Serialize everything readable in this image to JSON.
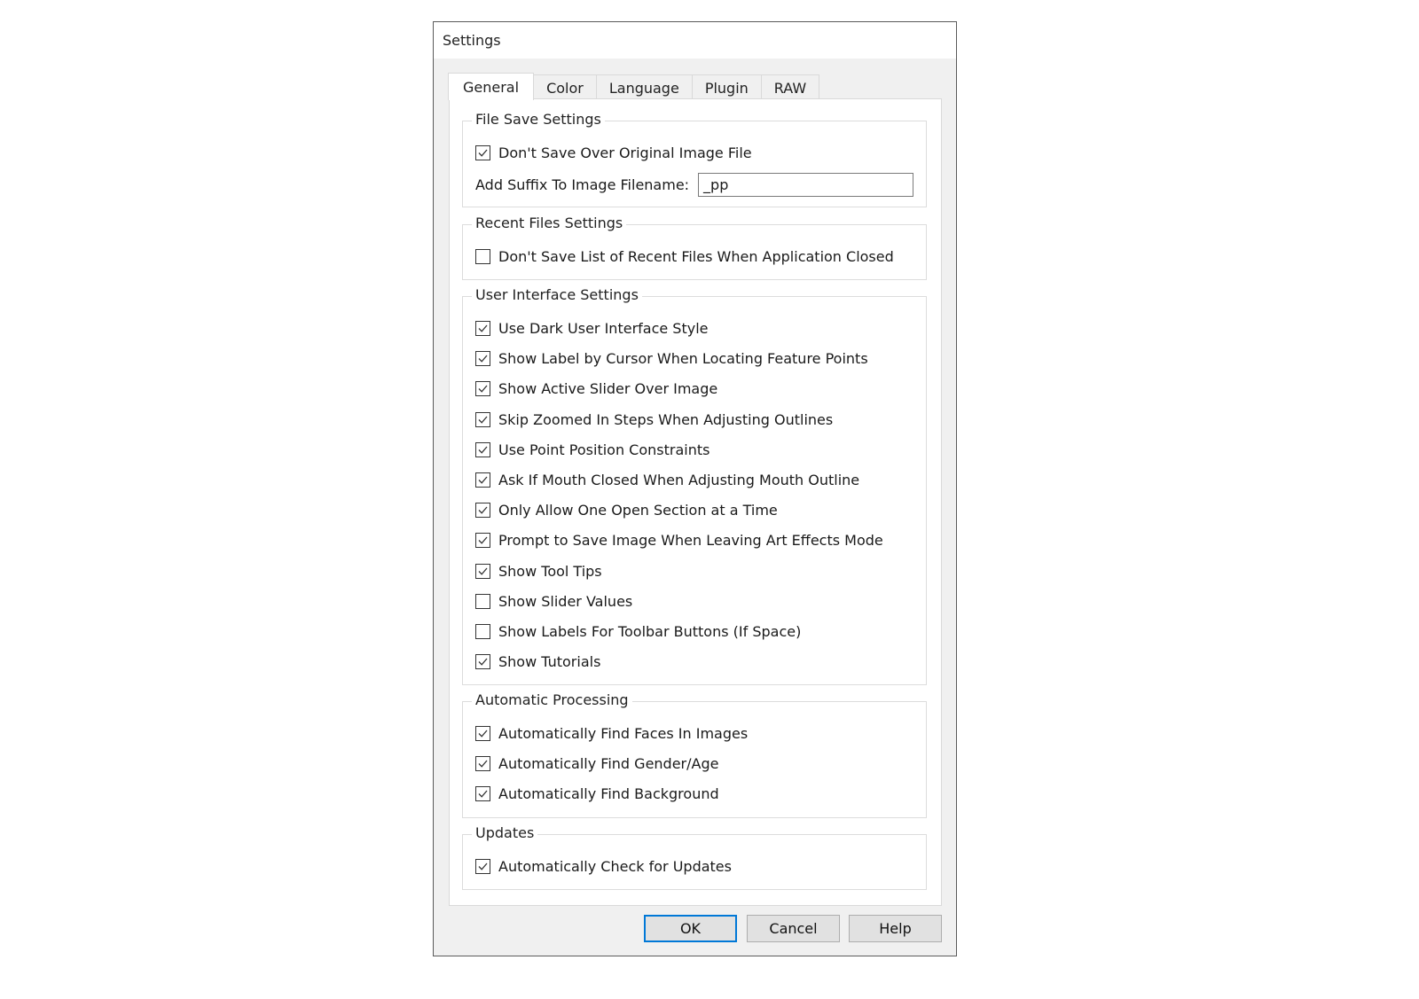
{
  "dialog": {
    "title": "Settings"
  },
  "tabs": [
    {
      "label": "General",
      "active": true
    },
    {
      "label": "Color",
      "active": false
    },
    {
      "label": "Language",
      "active": false
    },
    {
      "label": "Plugin",
      "active": false
    },
    {
      "label": "RAW",
      "active": false
    }
  ],
  "groups": {
    "file_save": {
      "title": "File Save Settings",
      "items": [
        {
          "label": "Don't Save Over Original Image File",
          "checked": true
        }
      ],
      "suffix_label": "Add Suffix To Image Filename:",
      "suffix_value": "_pp"
    },
    "recent_files": {
      "title": "Recent Files Settings",
      "items": [
        {
          "label": "Don't Save List of Recent Files When Application Closed",
          "checked": false
        }
      ]
    },
    "ui": {
      "title": "User Interface Settings",
      "items": [
        {
          "label": "Use Dark User Interface Style",
          "checked": true
        },
        {
          "label": "Show Label by Cursor When Locating Feature Points",
          "checked": true
        },
        {
          "label": "Show Active Slider Over Image",
          "checked": true
        },
        {
          "label": "Skip Zoomed In Steps When Adjusting Outlines",
          "checked": true
        },
        {
          "label": "Use Point Position Constraints",
          "checked": true
        },
        {
          "label": "Ask If Mouth Closed When Adjusting Mouth Outline",
          "checked": true
        },
        {
          "label": "Only Allow One Open Section at a Time",
          "checked": true
        },
        {
          "label": "Prompt to Save Image When Leaving Art Effects Mode",
          "checked": true
        },
        {
          "label": "Show Tool Tips",
          "checked": true
        },
        {
          "label": "Show Slider Values",
          "checked": false
        },
        {
          "label": "Show Labels For Toolbar Buttons (If Space)",
          "checked": false
        },
        {
          "label": "Show Tutorials",
          "checked": true
        }
      ]
    },
    "auto": {
      "title": "Automatic Processing",
      "items": [
        {
          "label": "Automatically Find Faces In Images",
          "checked": true
        },
        {
          "label": "Automatically Find Gender/Age",
          "checked": true
        },
        {
          "label": "Automatically Find Background",
          "checked": true
        }
      ]
    },
    "updates": {
      "title": "Updates",
      "items": [
        {
          "label": "Automatically Check for Updates",
          "checked": true
        }
      ]
    }
  },
  "buttons": {
    "ok": "OK",
    "cancel": "Cancel",
    "help": "Help"
  },
  "colors": {
    "default_button_border": "#0078d7"
  }
}
